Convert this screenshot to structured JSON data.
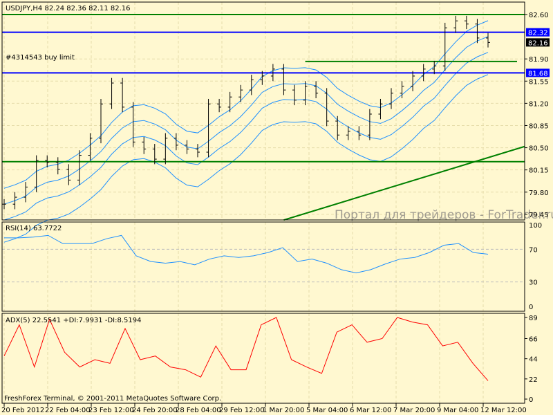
{
  "header": {
    "symbol_line": "USDJPY,H4  82.24 82.36 82.11 82.16",
    "order_label": "#4314543 buy limit"
  },
  "watermark": "Портал для трейдеров - ForTrader.ru",
  "footer": "FreshForex Terminal, © 2001-2011 MetaQuotes Software Corp.",
  "colors": {
    "bg": "#fff8d0",
    "bars": "#000000",
    "bands": "#1e90ff",
    "hline_green": "#008000",
    "hline_blue": "#0000ff",
    "rsi": "#1e90ff",
    "adx": "#ff0000"
  },
  "chart_data": [
    {
      "type": "line",
      "title": "USDJPY,H4",
      "ylim": [
        79.45,
        82.6
      ],
      "yticks": [
        "82.60",
        "81.90",
        "81.55",
        "81.20",
        "80.85",
        "80.50",
        "80.15",
        "79.80",
        "79.45"
      ],
      "price_tags": [
        {
          "label": "82.32",
          "value": 82.32,
          "color": "#0000ff"
        },
        {
          "label": "82.16",
          "value": 82.16,
          "color": "#000000"
        },
        {
          "label": "81.68",
          "value": 81.68,
          "color": "#0000ff"
        }
      ],
      "xticks": [
        "20 Feb 2012",
        "22 Feb 04:00",
        "23 Feb 12:00",
        "24 Feb 20:00",
        "28 Feb 04:00",
        "29 Feb 12:00",
        "1 Mar 20:00",
        "5 Mar 04:00",
        "6 Mar 12:00",
        "7 Mar 20:00",
        "9 Mar 04:00",
        "12 Mar 12:00"
      ],
      "closes": [
        79.61,
        79.72,
        79.88,
        80.3,
        80.27,
        80.16,
        79.99,
        80.38,
        80.65,
        81.19,
        81.52,
        81.14,
        80.59,
        80.48,
        80.32,
        80.65,
        80.54,
        80.48,
        80.43,
        81.19,
        81.14,
        81.3,
        81.41,
        81.57,
        81.63,
        81.74,
        81.41,
        81.25,
        81.47,
        81.36,
        80.92,
        80.7,
        80.76,
        80.7,
        81.03,
        81.19,
        81.36,
        81.47,
        81.63,
        81.74,
        81.79,
        82.39,
        82.5,
        82.45,
        82.23,
        82.16
      ],
      "horizontal_lines": [
        {
          "value": 82.6,
          "color": "#008000"
        },
        {
          "value": 82.32,
          "color": "#0000ff"
        },
        {
          "value": 81.68,
          "color": "#0000ff"
        },
        {
          "value": 80.28,
          "color": "#008000"
        }
      ],
      "buy_limit_line": {
        "value": 81.86,
        "start_index": 28
      },
      "trendline": {
        "from_index": 26,
        "from_value": 79.36,
        "to_value": 80.52
      }
    },
    {
      "type": "line",
      "title": "RSI(14) 63.7722",
      "ylim": [
        0,
        100
      ],
      "yticks": [
        "100",
        "70",
        "30",
        "0"
      ],
      "levels": [
        70,
        30
      ],
      "values": [
        84,
        84,
        85,
        87,
        77,
        77,
        77,
        83,
        87,
        62,
        55,
        53,
        55,
        51,
        58,
        62,
        60,
        62,
        66,
        72,
        55,
        58,
        53,
        45,
        41,
        45,
        52,
        58,
        60,
        66,
        75,
        77,
        66,
        64
      ]
    },
    {
      "type": "line",
      "title": "ADX(5) 22.5541 +DI:7.9931 -DI:8.5194",
      "ylim": [
        0,
        89
      ],
      "yticks": [
        "89",
        "66",
        "44",
        "22",
        "0"
      ],
      "values": [
        47,
        81,
        35,
        87,
        51,
        35,
        43,
        39,
        77,
        43,
        47,
        35,
        32,
        24,
        58,
        32,
        32,
        81,
        89,
        43,
        35,
        28,
        73,
        81,
        62,
        66,
        89,
        84,
        81,
        58,
        62,
        39,
        20
      ]
    }
  ]
}
